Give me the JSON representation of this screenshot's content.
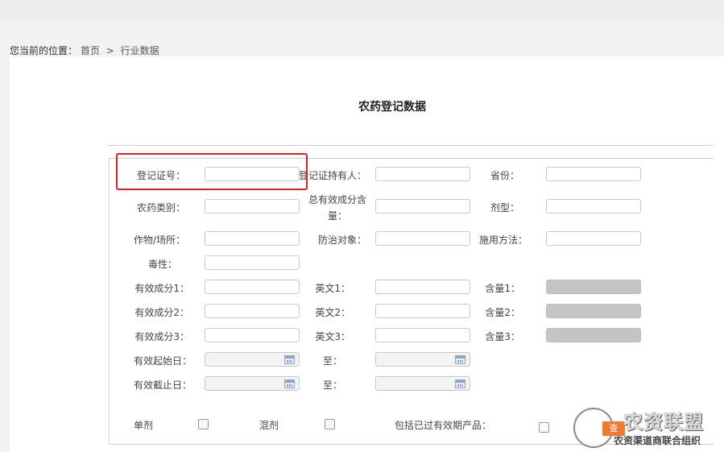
{
  "breadcrumb": {
    "prefix": "您当前的位置：",
    "home": "首页",
    "sep": ">",
    "current": "行业数据"
  },
  "page": {
    "title": "农药登记数据"
  },
  "form": {
    "reg_no": {
      "label": "登记证号：",
      "value": ""
    },
    "holder": {
      "label": "登记证持有人：",
      "value": ""
    },
    "province": {
      "label": "省份：",
      "value": ""
    },
    "pesticide_type": {
      "label": "农药类别：",
      "value": ""
    },
    "total_content": {
      "label": "总有效成分含量：",
      "value": ""
    },
    "formulation": {
      "label": "剂型：",
      "value": ""
    },
    "crop": {
      "label": "作物/场所：",
      "value": ""
    },
    "target": {
      "label": "防治对象：",
      "value": ""
    },
    "method": {
      "label": "施用方法：",
      "value": ""
    },
    "toxicity": {
      "label": "毒性：",
      "value": ""
    },
    "ingredient1": {
      "label": "有效成分1：",
      "value": ""
    },
    "english1": {
      "label": "英文1：",
      "value": ""
    },
    "content1": {
      "label": "含量1：",
      "value": ""
    },
    "ingredient2": {
      "label": "有效成分2：",
      "value": ""
    },
    "english2": {
      "label": "英文2：",
      "value": ""
    },
    "content2": {
      "label": "含量2：",
      "value": ""
    },
    "ingredient3": {
      "label": "有效成分3：",
      "value": ""
    },
    "english3": {
      "label": "英文3：",
      "value": ""
    },
    "content3": {
      "label": "含量3：",
      "value": ""
    },
    "start_date": {
      "label": "有效起始日：",
      "to_label": "至："
    },
    "end_date": {
      "label": "有效截止日：",
      "to_label": "至："
    },
    "single": {
      "label": "单剂",
      "checked": false
    },
    "mixed": {
      "label": "混剂",
      "checked": false
    },
    "include_expired": {
      "label": "包括已过有效期产品：",
      "checked": false
    }
  },
  "watermark": {
    "badge": "查",
    "title": "农资联盟",
    "subtitle": "农资渠道商联合组织"
  },
  "colors": {
    "highlight": "#e02020",
    "disabled_input": "#c4c4c4",
    "badge": "#f07a32"
  }
}
